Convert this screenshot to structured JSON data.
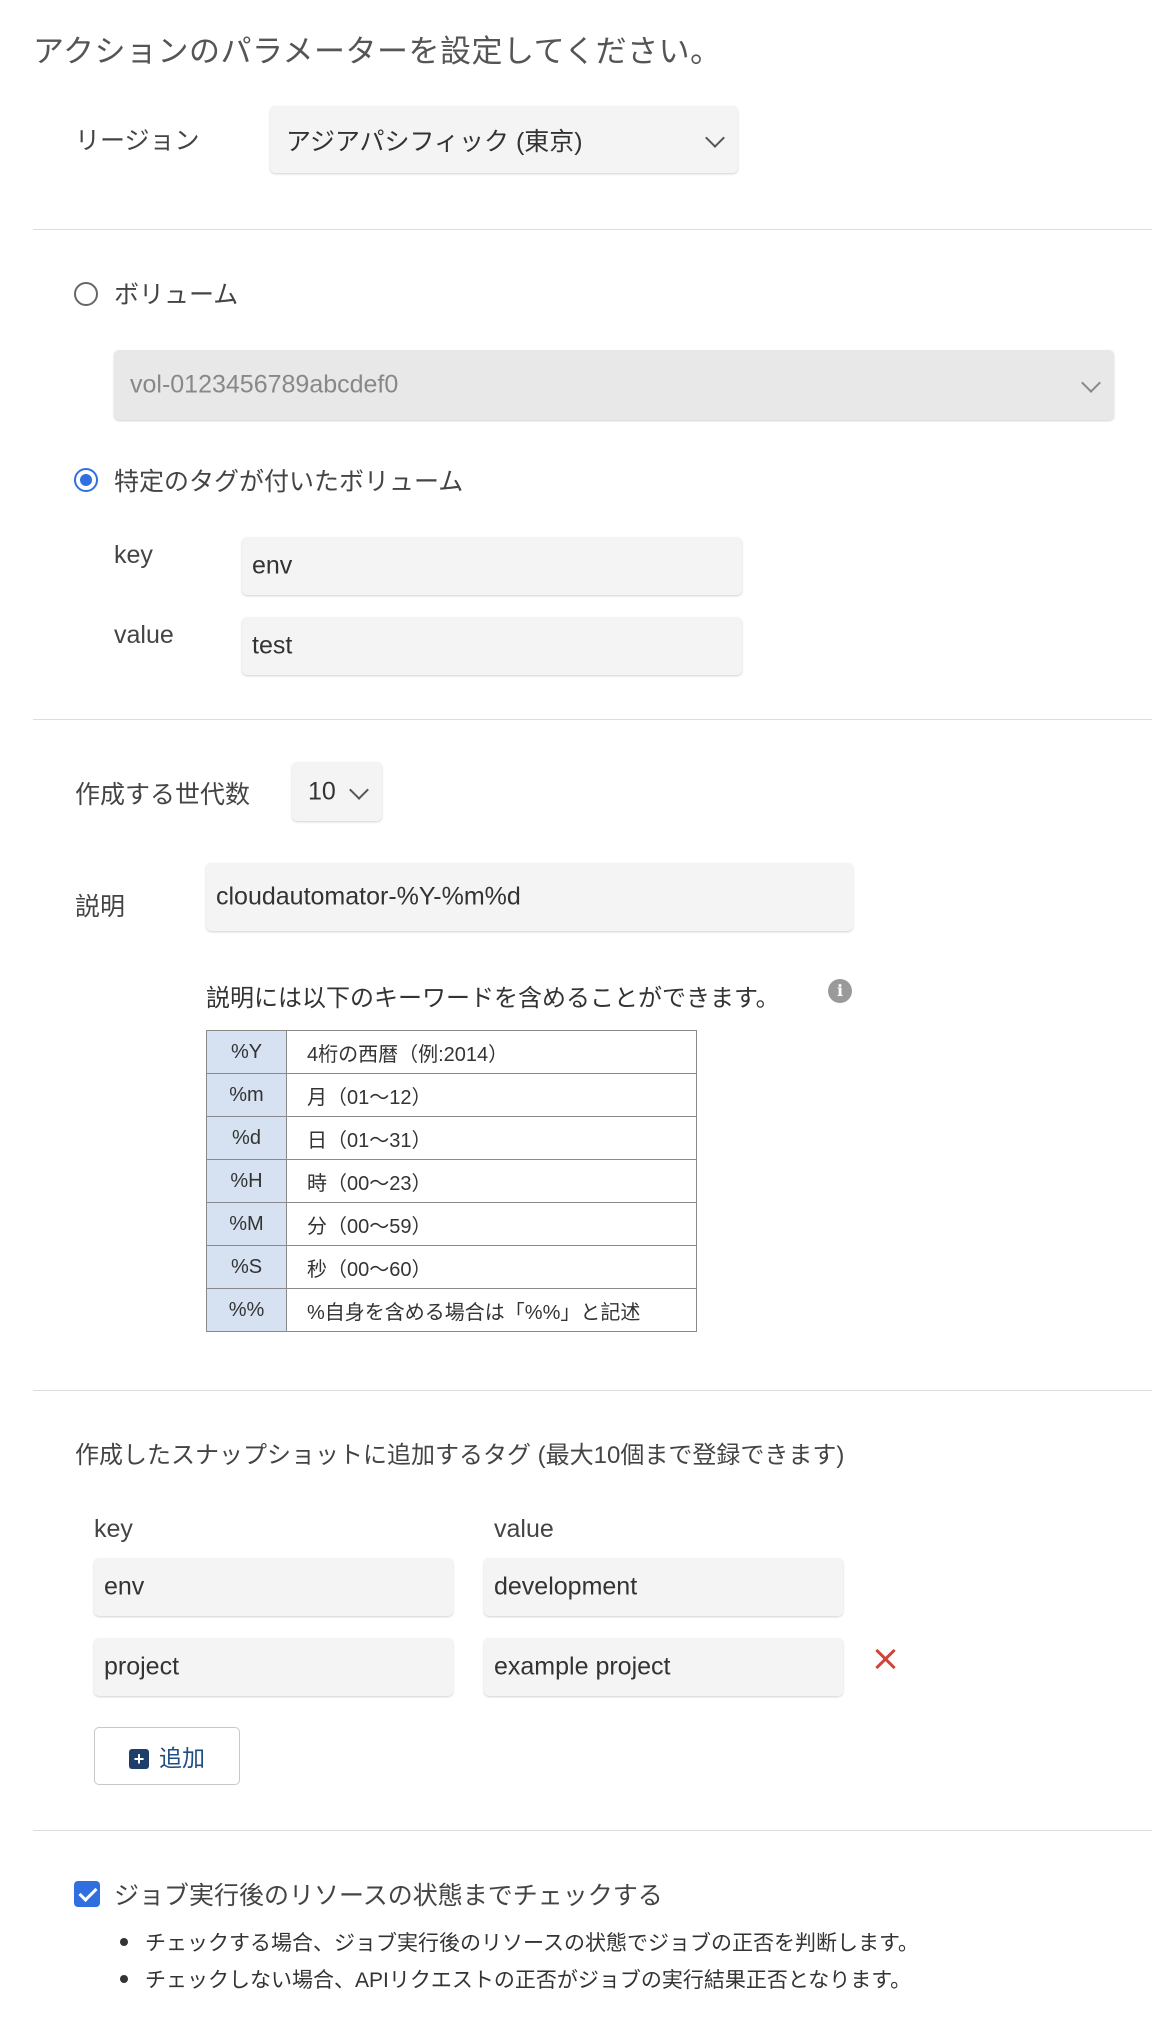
{
  "page_title": "アクションのパラメーターを設定してください。",
  "region": {
    "label": "リージョン",
    "selected": "アジアパシフィック (東京)"
  },
  "target": {
    "volume_option_label": "ボリューム",
    "volume_option_checked": false,
    "volume_select_value": "vol-0123456789abcdef0",
    "tagged_option_label": "特定のタグが付いたボリューム",
    "tagged_option_checked": true,
    "key_label": "key",
    "key_value": "env",
    "value_label": "value",
    "value_value": "test"
  },
  "generations": {
    "label": "作成する世代数",
    "selected": "10"
  },
  "description": {
    "label": "説明",
    "value": "cloudautomator-%Y-%m%d",
    "keyword_hint": "説明には以下のキーワードを含めることができます。",
    "info_icon": "info-icon",
    "keywords": [
      {
        "code": "%Y",
        "desc": "4桁の西暦（例:2014）"
      },
      {
        "code": "%m",
        "desc": "月（01〜12）"
      },
      {
        "code": "%d",
        "desc": "日（01〜31）"
      },
      {
        "code": "%H",
        "desc": "時（00〜23）"
      },
      {
        "code": "%M",
        "desc": "分（00〜59）"
      },
      {
        "code": "%S",
        "desc": "秒（00〜60）"
      },
      {
        "code": "%%",
        "desc": "%自身を含める場合は「%%」と記述"
      }
    ]
  },
  "snapshot_tags": {
    "heading": "作成したスナップショットに追加するタグ (最大10個まで登録できます)",
    "key_header": "key",
    "value_header": "value",
    "rows": [
      {
        "key": "env",
        "value": "development"
      },
      {
        "key": "project",
        "value": "example project"
      }
    ],
    "add_label": "追加"
  },
  "check_state": {
    "checked": true,
    "label": "ジョブ実行後のリソースの状態までチェックする",
    "notes": [
      "チェックする場合、ジョブ実行後のリソースの状態でジョブの正否を判断します。",
      "チェックしない場合、APIリクエストの正否がジョブの実行結果正否となります。"
    ]
  },
  "colors": {
    "accent": "#2f6fe0",
    "delete": "#d0453a",
    "table_header_bg": "#d6e1f1",
    "add_button_text": "#1f4f82"
  }
}
